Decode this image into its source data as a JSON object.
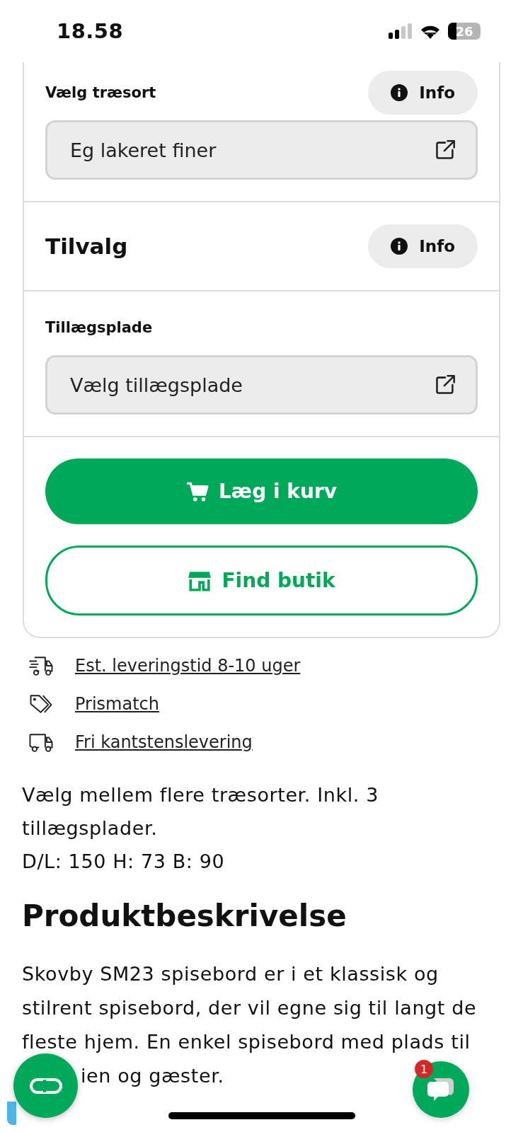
{
  "status_bar": {
    "time": "18.58",
    "battery": "26"
  },
  "options": [
    {
      "kind": "field",
      "label": "Vælg træsort",
      "info": "Info",
      "value": "Eg lakeret finer"
    },
    {
      "kind": "heading",
      "label": "Tilvalg",
      "info": "Info"
    },
    {
      "kind": "field",
      "label": "Tillægsplade",
      "value": "Vælg tillægsplade"
    }
  ],
  "buttons": [
    {
      "kind": "primary",
      "label": "Læg i kurv"
    },
    {
      "kind": "outline",
      "label": "Find butik"
    }
  ],
  "links": [
    {
      "kind": "fast-truck",
      "text": "Est. leveringstid 8-10 uger"
    },
    {
      "kind": "tag",
      "text": "Prismatch"
    },
    {
      "kind": "truck",
      "text": "Fri kantstenslevering"
    }
  ],
  "summary": [
    "Vælg mellem flere træsorter. Inkl. 3 tillægsplader.",
    "D/L: 150  H: 73  B: 90"
  ],
  "description": {
    "title": "Produktbeskrivelse",
    "text": "Skovby SM23 spisebord er i et klassisk og stilrent spisebord, der vil egne sig til langt de fleste hjem. En enkel spisebord med plads til",
    "text_after_overlay": "ien og gæster."
  },
  "chat": {
    "badge": "1"
  }
}
